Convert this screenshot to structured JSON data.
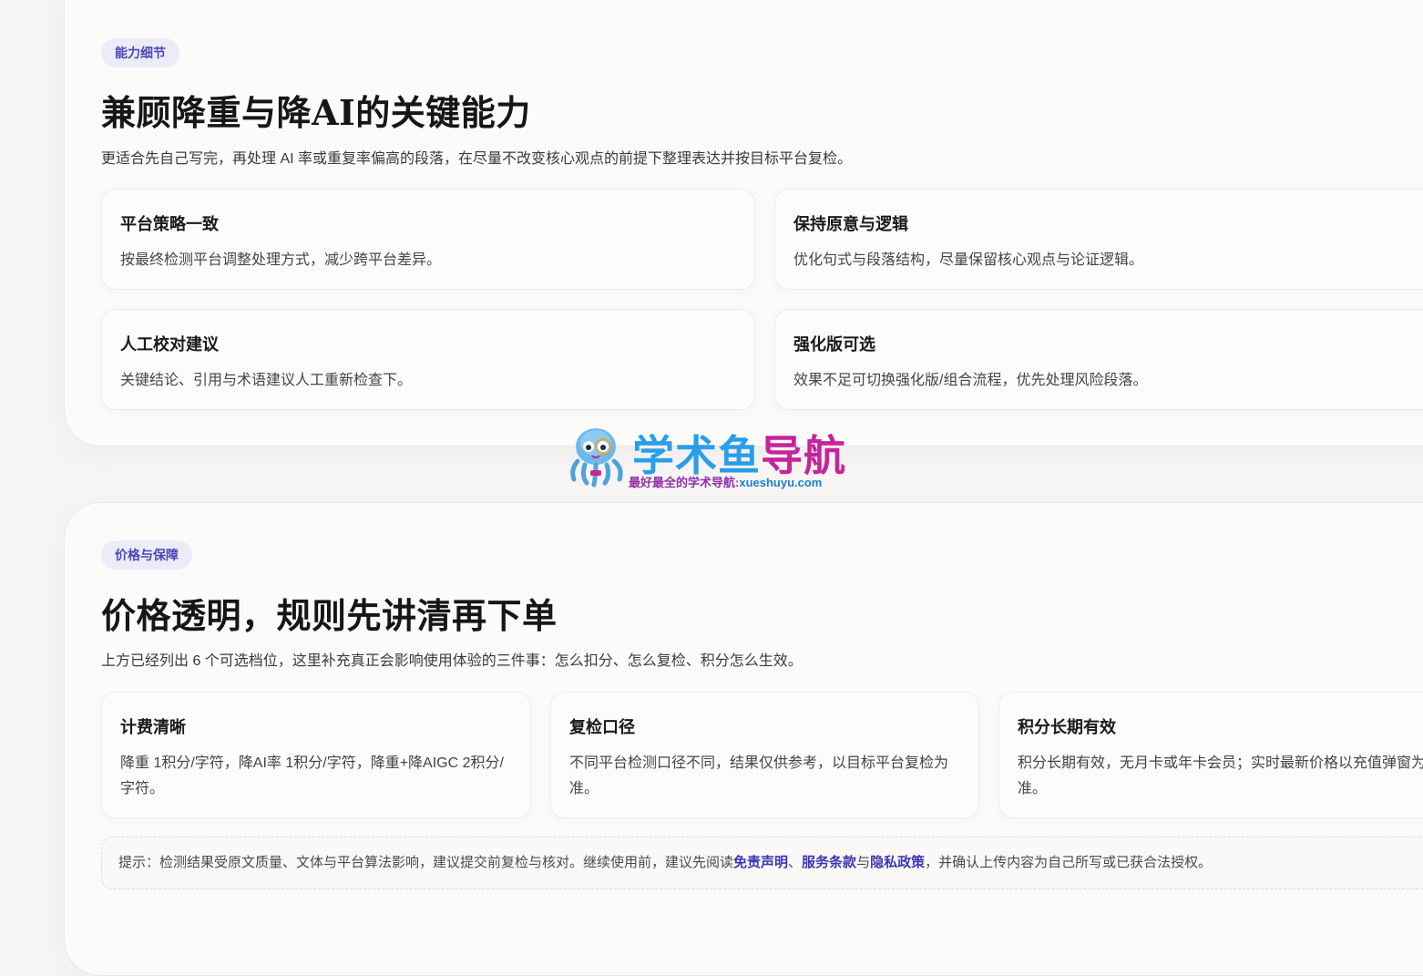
{
  "ability": {
    "pill": "能力细节",
    "title": "兼顾降重与降AI的关键能力",
    "desc": "更适合先自己写完，再处理 AI 率或重复率偏高的段落，在尽量不改变核心观点的前提下整理表达并按目标平台复检。",
    "cards": [
      {
        "title": "平台策略一致",
        "desc": "按最终检测平台调整处理方式，减少跨平台差异。"
      },
      {
        "title": "保持原意与逻辑",
        "desc": "优化句式与段落结构，尽量保留核心观点与论证逻辑。"
      },
      {
        "title": "人工校对建议",
        "desc": "关键结论、引用与术语建议人工重新检查下。"
      },
      {
        "title": "强化版可选",
        "desc": "效果不足可切换强化版/组合流程，优先处理风险段落。"
      }
    ]
  },
  "price": {
    "pill": "价格与保障",
    "title": "价格透明，规则先讲清再下单",
    "desc": "上方已经列出 6 个可选档位，这里补充真正会影响使用体验的三件事：怎么扣分、怎么复检、积分怎么生效。",
    "cards": [
      {
        "title": "计费清晰",
        "desc": "降重 1积分/字符，降AI率 1积分/字符，降重+降AIGC 2积分/字符。"
      },
      {
        "title": "复检口径",
        "desc": "不同平台检测口径不同，结果仅供参考，以目标平台复检为准。"
      },
      {
        "title": "积分长期有效",
        "desc": "积分长期有效，无月卡或年卡会员；实时最新价格以充值弹窗为准。"
      }
    ],
    "tip": {
      "prefix": "提示：检测结果受原文质量、文体与平台算法影响，建议提交前复检与核对。继续使用前，建议先阅读",
      "link1": "免责声明",
      "sep1": "、",
      "link2": "服务条款",
      "sep2": "与",
      "link3": "隐私政策",
      "suffix": "，并确认上传内容为自己所写或已获合法授权。"
    }
  },
  "watermark": {
    "title_a": "学术鱼",
    "title_b": "导航",
    "subtitle": "最好最全的学术导航:",
    "domain": "xueshuyu.com"
  },
  "colors": {
    "accent": "#4b46b8",
    "link": "#3c37b3",
    "pill_bg": "#ecebf8",
    "watermark_blue": "#2a9ee8",
    "watermark_magenta": "#c5259b"
  }
}
